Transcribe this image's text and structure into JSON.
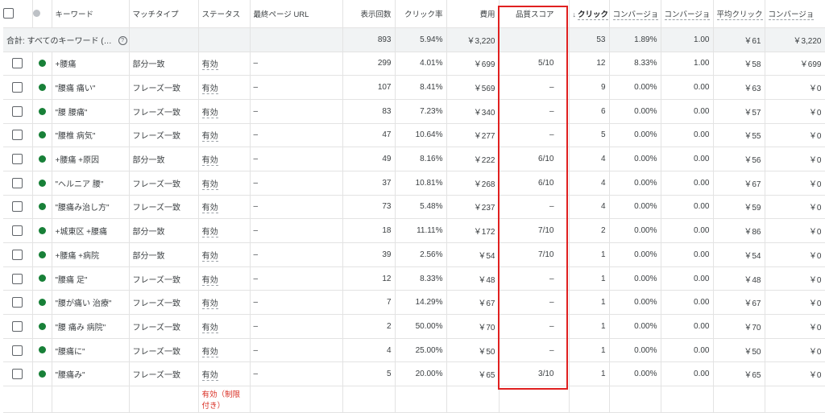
{
  "headers": {
    "keyword": "キーワード",
    "match_type": "マッチタイプ",
    "status": "ステータス",
    "final_url": "最終ページ URL",
    "impressions": "表示回数",
    "ctr": "クリック率",
    "cost": "費用",
    "quality_score": "品質スコア",
    "clicks": "クリック",
    "conv_rate": "コンバージョ",
    "conversions": "コンバージョ",
    "avg_cpc": "平均クリック",
    "cost_per_conv": "コンバージョ"
  },
  "total": {
    "label": "合計: すべてのキーワード (…",
    "impressions": "893",
    "ctr": "5.94%",
    "cost": "￥3,220",
    "clicks": "53",
    "conv_rate": "1.89%",
    "conversions": "1.00",
    "avg_cpc": "￥61",
    "cost_per_conv": "￥3,220"
  },
  "rows": [
    {
      "keyword": "+腰痛",
      "match": "部分一致",
      "status": "有効",
      "url": "–",
      "impr": "299",
      "ctr": "4.01%",
      "cost": "￥699",
      "qs": "5/10",
      "clicks": "12",
      "conv_rate": "8.33%",
      "conv": "1.00",
      "cpc": "￥58",
      "cpa": "￥699"
    },
    {
      "keyword": "\"腰痛 痛い\"",
      "match": "フレーズ一致",
      "status": "有効",
      "url": "–",
      "impr": "107",
      "ctr": "8.41%",
      "cost": "￥569",
      "qs": "–",
      "clicks": "9",
      "conv_rate": "0.00%",
      "conv": "0.00",
      "cpc": "￥63",
      "cpa": "￥0"
    },
    {
      "keyword": "\"腰 腰痛\"",
      "match": "フレーズ一致",
      "status": "有効",
      "url": "–",
      "impr": "83",
      "ctr": "7.23%",
      "cost": "￥340",
      "qs": "–",
      "clicks": "6",
      "conv_rate": "0.00%",
      "conv": "0.00",
      "cpc": "￥57",
      "cpa": "￥0"
    },
    {
      "keyword": "\"腰椎 病気\"",
      "match": "フレーズ一致",
      "status": "有効",
      "url": "–",
      "impr": "47",
      "ctr": "10.64%",
      "cost": "￥277",
      "qs": "–",
      "clicks": "5",
      "conv_rate": "0.00%",
      "conv": "0.00",
      "cpc": "￥55",
      "cpa": "￥0"
    },
    {
      "keyword": "+腰痛 +原因",
      "match": "部分一致",
      "status": "有効",
      "url": "–",
      "impr": "49",
      "ctr": "8.16%",
      "cost": "￥222",
      "qs": "6/10",
      "clicks": "4",
      "conv_rate": "0.00%",
      "conv": "0.00",
      "cpc": "￥56",
      "cpa": "￥0"
    },
    {
      "keyword": "\"ヘルニア 腰\"",
      "match": "フレーズ一致",
      "status": "有効",
      "url": "–",
      "impr": "37",
      "ctr": "10.81%",
      "cost": "￥268",
      "qs": "6/10",
      "clicks": "4",
      "conv_rate": "0.00%",
      "conv": "0.00",
      "cpc": "￥67",
      "cpa": "￥0"
    },
    {
      "keyword": "\"腰痛み治し方\"",
      "match": "フレーズ一致",
      "status": "有効",
      "url": "–",
      "impr": "73",
      "ctr": "5.48%",
      "cost": "￥237",
      "qs": "–",
      "clicks": "4",
      "conv_rate": "0.00%",
      "conv": "0.00",
      "cpc": "￥59",
      "cpa": "￥0"
    },
    {
      "keyword": "+城東区 +腰痛",
      "match": "部分一致",
      "status": "有効",
      "url": "–",
      "impr": "18",
      "ctr": "11.11%",
      "cost": "￥172",
      "qs": "7/10",
      "clicks": "2",
      "conv_rate": "0.00%",
      "conv": "0.00",
      "cpc": "￥86",
      "cpa": "￥0"
    },
    {
      "keyword": "+腰痛 +病院",
      "match": "部分一致",
      "status": "有効",
      "url": "–",
      "impr": "39",
      "ctr": "2.56%",
      "cost": "￥54",
      "qs": "7/10",
      "clicks": "1",
      "conv_rate": "0.00%",
      "conv": "0.00",
      "cpc": "￥54",
      "cpa": "￥0"
    },
    {
      "keyword": "\"腰痛 足\"",
      "match": "フレーズ一致",
      "status": "有効",
      "url": "–",
      "impr": "12",
      "ctr": "8.33%",
      "cost": "￥48",
      "qs": "–",
      "clicks": "1",
      "conv_rate": "0.00%",
      "conv": "0.00",
      "cpc": "￥48",
      "cpa": "￥0"
    },
    {
      "keyword": "\"腰が痛い 治療\"",
      "match": "フレーズ一致",
      "status": "有効",
      "url": "–",
      "impr": "7",
      "ctr": "14.29%",
      "cost": "￥67",
      "qs": "–",
      "clicks": "1",
      "conv_rate": "0.00%",
      "conv": "0.00",
      "cpc": "￥67",
      "cpa": "￥0"
    },
    {
      "keyword": "\"腰 痛み 病院\"",
      "match": "フレーズ一致",
      "status": "有効",
      "url": "–",
      "impr": "2",
      "ctr": "50.00%",
      "cost": "￥70",
      "qs": "–",
      "clicks": "1",
      "conv_rate": "0.00%",
      "conv": "0.00",
      "cpc": "￥70",
      "cpa": "￥0"
    },
    {
      "keyword": "\"腰痛に\"",
      "match": "フレーズ一致",
      "status": "有効",
      "url": "–",
      "impr": "4",
      "ctr": "25.00%",
      "cost": "￥50",
      "qs": "–",
      "clicks": "1",
      "conv_rate": "0.00%",
      "conv": "0.00",
      "cpc": "￥50",
      "cpa": "￥0"
    },
    {
      "keyword": "\"腰痛み\"",
      "match": "フレーズ一致",
      "status": "有効",
      "url": "–",
      "impr": "5",
      "ctr": "20.00%",
      "cost": "￥65",
      "qs": "3/10",
      "clicks": "1",
      "conv_rate": "0.00%",
      "conv": "0.00",
      "cpc": "￥65",
      "cpa": "￥0"
    }
  ],
  "extra_row": {
    "status": "有効（制限付き）"
  },
  "colors": {
    "enabled_dot": "#188038",
    "highlight": "#e02020",
    "limited_text": "#d93025"
  }
}
